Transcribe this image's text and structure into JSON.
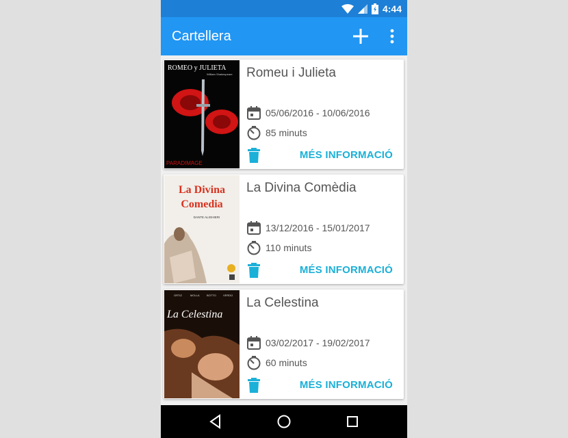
{
  "status_bar": {
    "time": "4:44"
  },
  "app_bar": {
    "title": "Cartellera"
  },
  "cards": [
    {
      "title": "Romeu i Julieta",
      "dates": "05/06/2016 - 10/06/2016",
      "duration": "85 minuts",
      "action": "MÉS INFORMACIÓ",
      "poster": {
        "title": "ROMEO y JULIETA",
        "author": "William Shakespeare",
        "footer": "PARADIMAGE"
      }
    },
    {
      "title": "La Divina Comèdia",
      "dates": "13/12/2016 - 15/01/2017",
      "duration": "110 minuts",
      "action": "MÉS INFORMACIÓ",
      "poster": {
        "title_line1": "La Divina",
        "title_line2": "Comedia",
        "author": "DANTE ALIGHIERI"
      }
    },
    {
      "title": "La Celestina",
      "dates": "03/02/2017 - 19/02/2017",
      "duration": "60 minuts",
      "action": "MÉS INFORMACIÓ",
      "poster": {
        "title": "La Celestina",
        "cast": [
          "ORTIZ",
          "MOLLA",
          "BOTTO",
          "VERDÚ"
        ]
      }
    }
  ],
  "colors": {
    "primary": "#2196f3",
    "primary_dark": "#1d7fd6",
    "accent": "#1ab0d8"
  }
}
